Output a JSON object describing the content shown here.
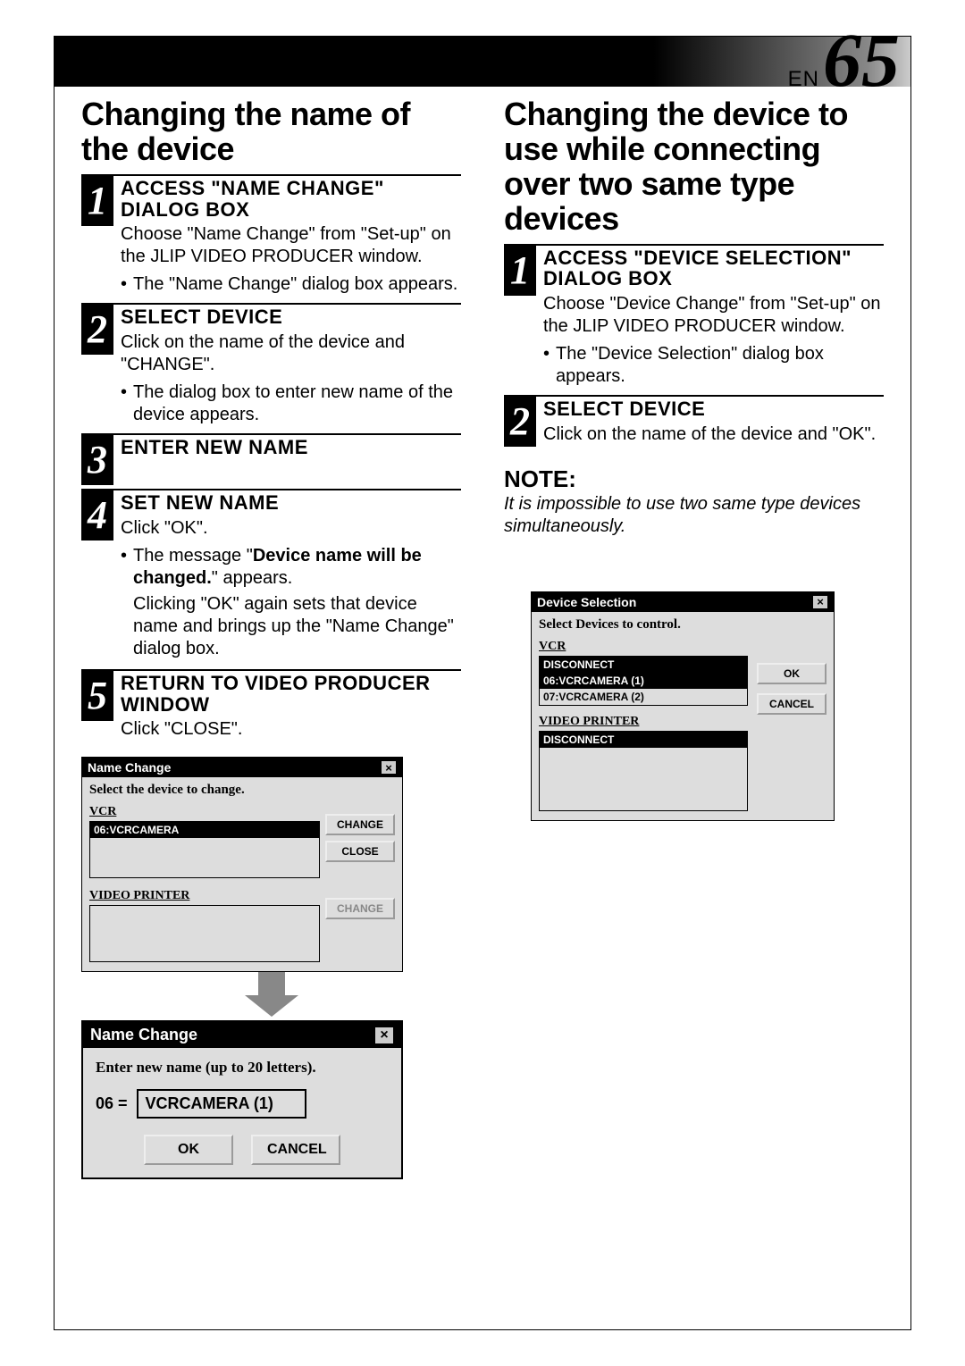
{
  "page": {
    "lang": "EN",
    "number": "65"
  },
  "left": {
    "heading": "Changing the name of the device",
    "steps": [
      {
        "num": "1",
        "title": "ACCESS \"NAME CHANGE\" DIALOG BOX",
        "text": "Choose \"Name Change\" from \"Set-up\" on the JLIP VIDEO PRODUCER window.",
        "bullet": "The \"Name Change\" dialog box appears."
      },
      {
        "num": "2",
        "title": "SELECT DEVICE",
        "text": "Click on the name of the device and \"CHANGE\".",
        "bullet": "The dialog box to enter new name of the device appears."
      },
      {
        "num": "3",
        "title": "ENTER NEW NAME",
        "text": "",
        "bullet": ""
      },
      {
        "num": "4",
        "title": "SET NEW NAME",
        "text": "Click \"OK\".",
        "bullet_pre": "The message \"",
        "bullet_bold": "Device name will be changed.",
        "bullet_post": "\" appears.",
        "text2": "Clicking \"OK\" again sets that device name and brings up the \"Name Change\" dialog box."
      },
      {
        "num": "5",
        "title": "RETURN TO VIDEO PRODUCER WINDOW",
        "text": "Click \"CLOSE\".",
        "bullet": ""
      }
    ]
  },
  "right": {
    "heading": "Changing the device to use while connecting over two same type devices",
    "steps": [
      {
        "num": "1",
        "title": "ACCESS \"DEVICE SELECTION\" DIALOG BOX",
        "text": "Choose \"Device Change\" from \"Set-up\" on the JLIP VIDEO PRODUCER window.",
        "bullet": "The \"Device Selection\" dialog box appears."
      },
      {
        "num": "2",
        "title": "SELECT DEVICE",
        "text": "Click on the name of the device and \"OK\".",
        "bullet": ""
      }
    ],
    "note_h": "NOTE:",
    "note_t": "It is impossible to use two same type devices simultaneously."
  },
  "dlg_namechange": {
    "title": "Name Change",
    "instr": "Select the device to change.",
    "sec_vcr": "VCR",
    "vcr_items": [
      "06:VCRCAMERA"
    ],
    "sec_vp": "VIDEO PRINTER",
    "btn_change": "CHANGE",
    "btn_close": "CLOSE",
    "btn_change2": "CHANGE"
  },
  "dlg_nc_input": {
    "title": "Name Change",
    "instr": "Enter new name (up to 20 letters).",
    "id": "06  =",
    "value": "VCRCAMERA (1)",
    "ok": "OK",
    "cancel": "CANCEL"
  },
  "dlg_devicesel": {
    "title": "Device Selection",
    "instr": "Select Devices to control.",
    "sec_vcr": "VCR",
    "vcr_items": [
      "DISCONNECT",
      "06:VCRCAMERA (1)",
      "07:VCRCAMERA (2)"
    ],
    "sec_vp": "VIDEO PRINTER",
    "vp_items": [
      "DISCONNECT"
    ],
    "ok": "OK",
    "cancel": "CANCEL"
  }
}
